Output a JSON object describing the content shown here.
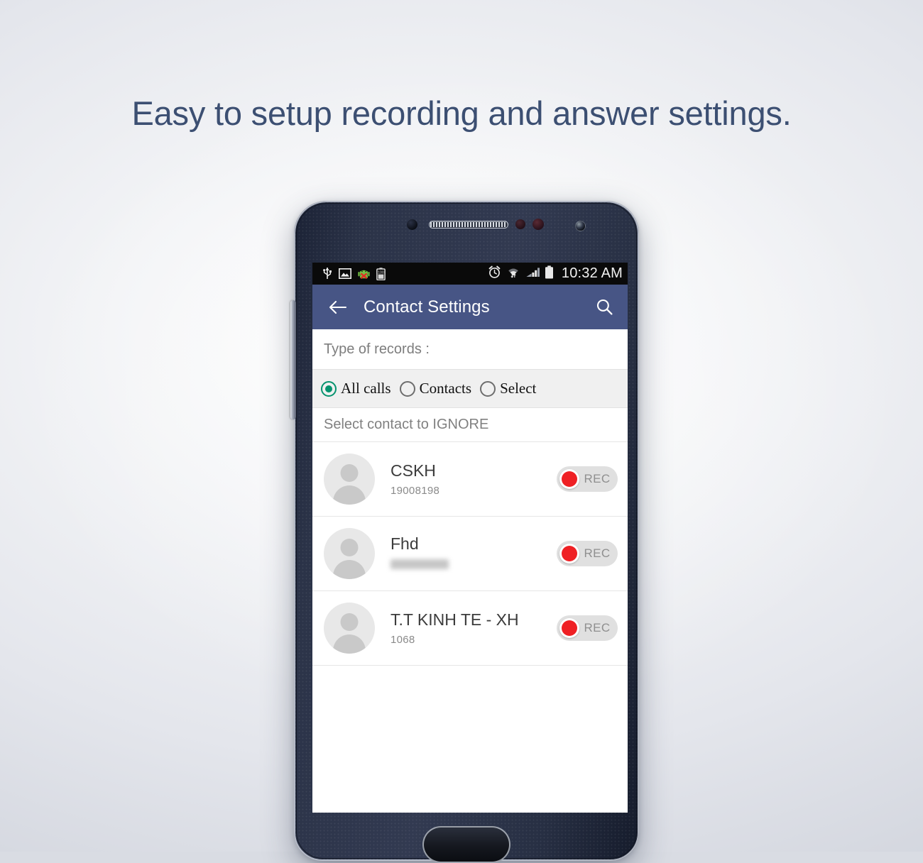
{
  "promo": {
    "headline": "Easy to setup recording and answer settings.",
    "headline_color": "#3c4f72"
  },
  "device": {
    "name": "android-phone-mockup",
    "body_color": "#2b3348"
  },
  "status_bar": {
    "time": "10:32 AM",
    "left_icons": [
      "usb-icon",
      "screenshot-icon",
      "android-error-icon",
      "battery-saver-icon"
    ],
    "right_icons": [
      "alarm-icon",
      "wifi-icon",
      "signal-icon",
      "battery-icon"
    ],
    "background": "#0a0a0a"
  },
  "app_bar": {
    "title": "Contact Settings",
    "back_icon": "arrow-back-icon",
    "search_icon": "search-icon",
    "background": "#475585",
    "text_color": "#ffffff"
  },
  "content": {
    "records_type_label": "Type of records :",
    "radio_group": {
      "selected_index": 0,
      "accent_color": "#06936f",
      "options": [
        {
          "label": "All calls",
          "selected": true
        },
        {
          "label": "Contacts",
          "selected": false
        },
        {
          "label": "Select",
          "selected": false
        }
      ]
    },
    "ignore_header": "Select contact to IGNORE",
    "toggle_label": "REC",
    "toggle_dot_color": "#ef2024",
    "contacts": [
      {
        "name": "CSKH",
        "number": "19008198",
        "redacted": false,
        "toggle": "REC"
      },
      {
        "name": "Fhd",
        "number": "",
        "redacted": true,
        "toggle": "REC"
      },
      {
        "name": "T.T KINH TE - XH",
        "number": "1068",
        "redacted": false,
        "toggle": "REC"
      }
    ]
  }
}
